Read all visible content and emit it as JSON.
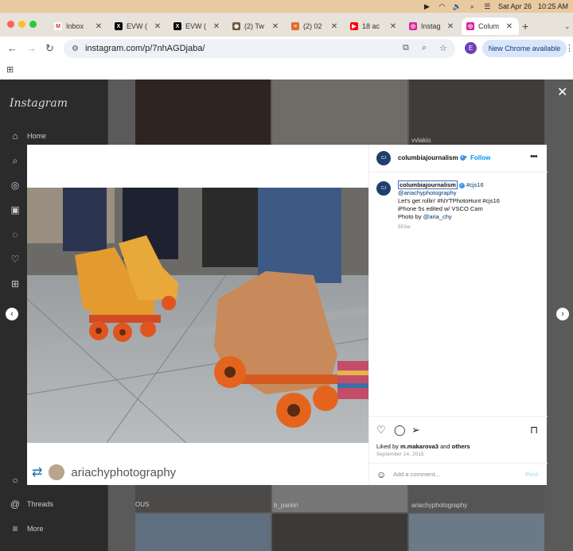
{
  "menubar": {
    "datetime_date": "Sat Apr 26",
    "datetime_time": "10:25 AM"
  },
  "tabs": [
    {
      "label": "Inbox",
      "icon": "gmail-icon"
    },
    {
      "label": "EVW (",
      "icon": "x-icon"
    },
    {
      "label": "EVW (",
      "icon": "x-icon"
    },
    {
      "label": "(2) Tw",
      "icon": "tweetdeck-icon"
    },
    {
      "label": "(2) 02",
      "icon": "substack-icon"
    },
    {
      "label": "18 ac",
      "icon": "youtube-icon"
    },
    {
      "label": "Instag",
      "icon": "instagram-icon"
    },
    {
      "label": "Colum",
      "icon": "instagram-icon"
    }
  ],
  "toolbar": {
    "url": "instagram.com/p/7nhAGDjaba/",
    "profile_initial": "E",
    "new_chrome_label": "New Chrome available"
  },
  "sidebar": {
    "logo": "Instagram",
    "items": [
      {
        "label": "Home"
      },
      {
        "label": ""
      },
      {
        "label": ""
      },
      {
        "label": ""
      },
      {
        "label": ""
      },
      {
        "label": ""
      },
      {
        "label": ""
      }
    ],
    "threads_label": "Threads",
    "more_label": "More"
  },
  "grid": {
    "cap1": "vvlakio",
    "cap2": "b_parkin",
    "cap3": "ariachyphotography",
    "cap4": "OUS"
  },
  "post": {
    "author": "columbiajournalism",
    "follow": "Follow",
    "caption_user": "columbiajournalism",
    "caption_tag": "#cjs16",
    "caption_line2": "@ariachyphotography",
    "caption_line3": "Let's get rollin' #NYTPhotoHunt #cjs16",
    "caption_line4": "iPhone 5s edited w/ VSCO Cam",
    "caption_line5_prefix": "Photo by ",
    "caption_line5_user": "@aria_chy",
    "time_ago": "501w",
    "liked_prefix": "Liked by ",
    "liked_user": "m.makarova3",
    "liked_suffix": " and ",
    "liked_others": "others",
    "date": "September 14, 2015",
    "comment_placeholder": "Add a comment...",
    "post_button": "Post",
    "credit_name": "ariachyphotography"
  },
  "colors": {
    "ig_blue": "#0095f6",
    "tab_bar": "#e7e2da",
    "menubar": "#e9c9a0"
  }
}
